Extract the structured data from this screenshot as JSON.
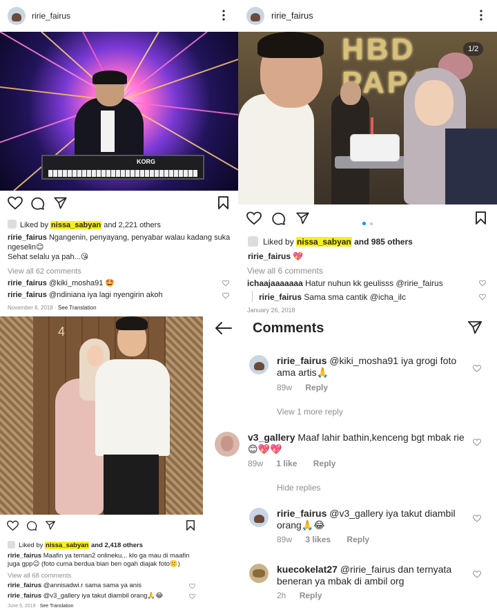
{
  "post1": {
    "username": "ririe_fairus",
    "liked_by_prefix": "Liked by",
    "liked_by_user": "nissa_sabyan",
    "liked_by_suffix": "and 2,221 others",
    "caption_user": "ririe_fairus",
    "caption_text": "Ngangenin, penyayang, penyabar walau kadang suka ngeselin😊",
    "caption_line2": "Sehat selalu ya pah...😘",
    "view_all": "View all 62 comments",
    "comments": [
      {
        "user": "ririe_fairus",
        "text": "@kiki_mosha91 🤩"
      },
      {
        "user": "ririe_fairus",
        "text": "@ndiniana iya lagi nyengirin akoh"
      }
    ],
    "date": "November 6, 2018",
    "see_translation": "See Translation",
    "photo_brand": "KORG"
  },
  "post2": {
    "username": "ririe_fairus",
    "carousel": "1/2",
    "liked_by_prefix": "Liked by",
    "liked_by_user": "nissa_sabyan",
    "liked_by_suffix": "and 985 others",
    "caption_user": "ririe_fairus",
    "caption_text": "💖",
    "view_all": "View all 6 comments",
    "comments": [
      {
        "user": "ichaajaaaaaaa",
        "text": "Hatur nuhun kk geulisss @ririe_fairus"
      },
      {
        "user": "ririe_fairus",
        "text": "Sama sma cantik @icha_ilc"
      }
    ],
    "date": "January 26, 2018",
    "balloons": "HBD PAPA"
  },
  "post3": {
    "liked_by_prefix": "Liked by",
    "liked_by_user": "nissa_sabyan",
    "liked_by_suffix": "and 2,418 others",
    "caption_user": "ririe_fairus",
    "caption_text": "Maafin ya teman2 onlineku... klo ga mau di maafin juga gpp😉 (foto cuma berdua bian ben ogah diajak foto🙂)",
    "view_all": "View all 68 comments",
    "comments": [
      {
        "user": "ririe_fairus",
        "text": "@annisadwi.r sama sama ya anis"
      },
      {
        "user": "ririe_fairus",
        "text": "@v3_gallery iya takut diambil orang🙏😂"
      }
    ],
    "date": "June 5, 2019",
    "see_translation": "See Translation",
    "door_number": "4"
  },
  "comments_panel": {
    "title": "Comments",
    "items": [
      {
        "user": "ririe_fairus",
        "text": "@kiki_mosha91 iya grogi foto ama artis🙏",
        "time": "89w",
        "likes": "",
        "reply": "Reply"
      },
      {
        "view_more": "View 1 more reply"
      },
      {
        "user": "v3_gallery",
        "text": "Maaf lahir bathin,kenceng bgt mbak rie 😊💖💖",
        "time": "89w",
        "likes": "1 like",
        "reply": "Reply"
      },
      {
        "hide": "Hide replies"
      },
      {
        "user": "ririe_fairus",
        "text": "@v3_gallery iya takut diambil orang🙏😂",
        "time": "89w",
        "likes": "3 likes",
        "reply": "Reply"
      },
      {
        "user": "kuecokelat27",
        "text": "@ririe_fairus dan ternyata beneran ya mbak di ambil org",
        "time": "2h",
        "likes": "",
        "reply": "Reply"
      }
    ]
  }
}
